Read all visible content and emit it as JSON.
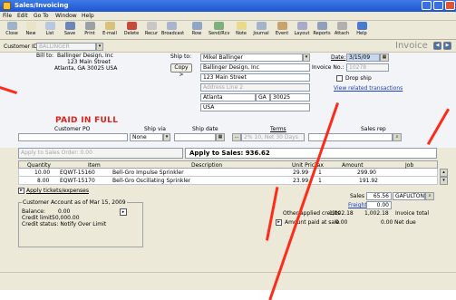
{
  "window": {
    "title": "Sales/Invoicing"
  },
  "menu": [
    "File",
    "Edit",
    "Go To",
    "Window",
    "Help"
  ],
  "toolbar": [
    {
      "label": "Close",
      "icon": "close-icon",
      "color": "#9fb3c8"
    },
    {
      "label": "New",
      "icon": "new-document-icon",
      "color": "#e9e4c4"
    },
    {
      "label": "List",
      "icon": "list-icon",
      "color": "#b8c8e0"
    },
    {
      "label": "Save",
      "icon": "save-icon",
      "color": "#6d86b8"
    },
    {
      "label": "Print",
      "icon": "print-icon",
      "color": "#9aa0a6"
    },
    {
      "label": "E-mail",
      "icon": "email-icon",
      "color": "#d8c27a"
    },
    {
      "label": "Delete",
      "icon": "delete-icon",
      "color": "#c94a3a"
    },
    {
      "label": "Recur",
      "icon": "recur-icon",
      "color": "#c7c7c7"
    },
    {
      "label": "Broadcast",
      "icon": "broadcast-icon",
      "color": "#a6b6cc"
    },
    {
      "label": "Row",
      "icon": "row-icon",
      "color": "#8fa6c8"
    },
    {
      "label": "Send/Rcv",
      "icon": "send-receive-icon",
      "color": "#7fb07a"
    },
    {
      "label": "Note",
      "icon": "note-icon",
      "color": "#e9d98a"
    },
    {
      "label": "Journal",
      "icon": "journal-icon",
      "color": "#a3b3c9"
    },
    {
      "label": "Event",
      "icon": "event-icon",
      "color": "#c9a36c"
    },
    {
      "label": "Layout",
      "icon": "layout-icon",
      "color": "#a9a9c9"
    },
    {
      "label": "Reports",
      "icon": "reports-icon",
      "color": "#8fa0b8"
    },
    {
      "label": "Attach",
      "icon": "attach-icon",
      "color": "#b0b0b0"
    },
    {
      "label": "Help",
      "icon": "help-icon",
      "color": "#4a7ad0"
    }
  ],
  "customer": {
    "label": "Customer ID:",
    "value": "BALLINGER"
  },
  "header": {
    "title": "Invoice"
  },
  "billto": {
    "label": "Bill to:",
    "lines": [
      "Ballinger Design, Inc",
      "123 Main Street",
      "Atlanta, GA 30025 USA"
    ]
  },
  "paid_stamp": "PAID IN FULL",
  "shipto": {
    "label": "Ship to:",
    "copy_label": "Copy >",
    "name": "Mikel Ballinger",
    "company": "Ballinger Design, Inc",
    "address1": "123 Main Street",
    "address2": "Address Line 2",
    "city": "Atlanta",
    "state": "GA",
    "zip": "30025",
    "country": "USA"
  },
  "date": {
    "label": "Date:",
    "value": "3/15/09"
  },
  "invoice_no": {
    "label": "Invoice No.:",
    "value": "10278"
  },
  "drop_ship": {
    "label": "Drop ship"
  },
  "related_link": "View related transactions",
  "terms_row": {
    "customer_po_label": "Customer PO",
    "ship_via_label": "Ship via",
    "ship_via_value": "None",
    "ship_date_label": "Ship date",
    "terms_label": "Terms",
    "terms_value": "2% 10, Net 30 Days",
    "sales_rep_label": "Sales rep"
  },
  "apply": {
    "sales_order_placeholder": "Apply to Sales Order: 0.00",
    "apply_sales": "Apply to Sales: 936.62"
  },
  "grid": {
    "headers": [
      "Quantity",
      "Item",
      "Description",
      "Unit Price",
      "Tax",
      "Amount",
      "Job"
    ],
    "rows": [
      [
        "10.00",
        "EQWT-15160",
        "Bell-Gro Impulse Sprinkler",
        "29.99",
        "1",
        "299.90",
        ""
      ],
      [
        "8.00",
        "EQWT-15170",
        "Bell-Gro Oscillating Sprinkler",
        "23.99",
        "1",
        "191.92",
        ""
      ]
    ]
  },
  "apply_tickets": "Apply tickets/expenses",
  "account": {
    "title": "Customer Account as of Mar 15, 2009",
    "balance_label": "Balance:",
    "balance_value": "0.00",
    "limit_label": "Credit limit:",
    "limit_value": "50,000.00",
    "status": "Credit status: Notify Over Limit"
  },
  "totals": {
    "sales_tax_label": "Sales tax:",
    "sales_tax_value": "65.56",
    "sales_tax_agency": "GAFULTON",
    "freight_label": "Freight:",
    "freight_value": "0.00",
    "other_applied_label": "Other applied credits",
    "other_applied_value": "1,002.18",
    "invoice_total_value": "1,002.18",
    "invoice_total_label": "Invoice total",
    "amount_paid_label": "Amount paid at sale",
    "amount_paid_value": "0.00",
    "net_due_value": "0.00",
    "net_due_label": "Net due"
  },
  "colors": {
    "title_bar": "#1d55cf",
    "paid_stamp": "#e0221a",
    "callout": "#ff2a1a",
    "link": "#1a3fbf"
  }
}
